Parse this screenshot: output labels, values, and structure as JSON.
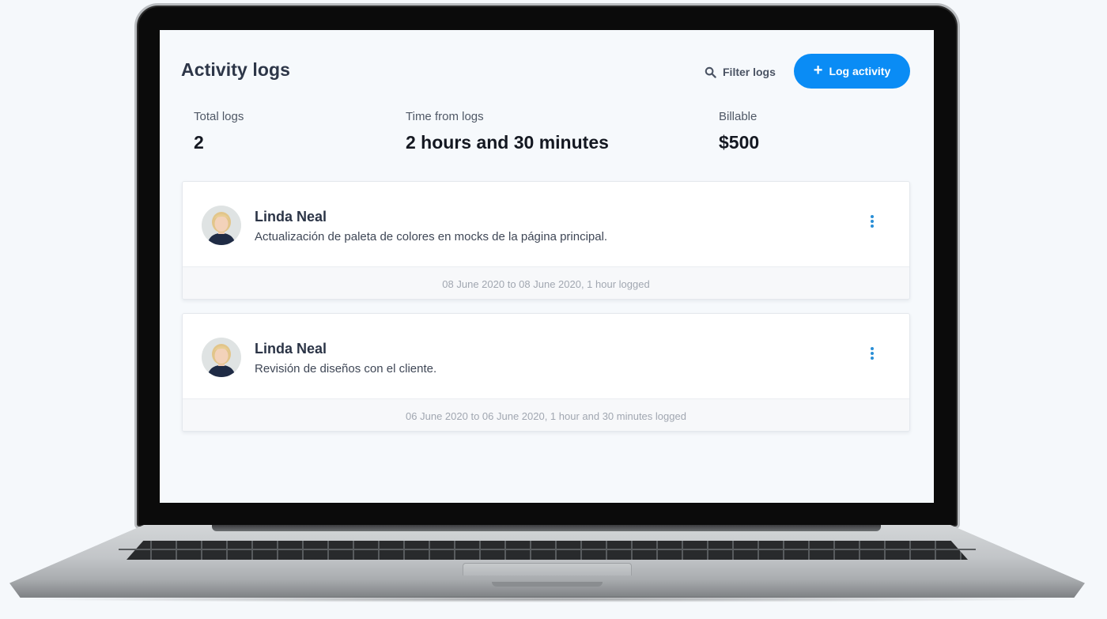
{
  "header": {
    "title": "Activity logs",
    "filter_label": "Filter logs",
    "log_activity_label": "Log activity"
  },
  "stats": [
    {
      "label": "Total logs",
      "value": "2"
    },
    {
      "label": "Time from logs",
      "value": "2 hours and 30 minutes"
    },
    {
      "label": "Billable",
      "value": "$500"
    }
  ],
  "logs": [
    {
      "user": "Linda Neal",
      "description": "Actualización de paleta de colores en mocks de la página principal.",
      "footer": "08 June 2020 to 08 June 2020, 1 hour logged"
    },
    {
      "user": "Linda Neal",
      "description": "Revisión de diseños con el cliente.",
      "footer": "06 June 2020 to 06 June 2020, 1 hour and 30 minutes logged"
    }
  ],
  "icons": {
    "filter": "search-icon",
    "add": "plus-icon",
    "more": "more-vertical-icon"
  },
  "colors": {
    "accent": "#0a8cf5",
    "more_icon": "#2a8fd6",
    "background": "#f6f9fc"
  }
}
